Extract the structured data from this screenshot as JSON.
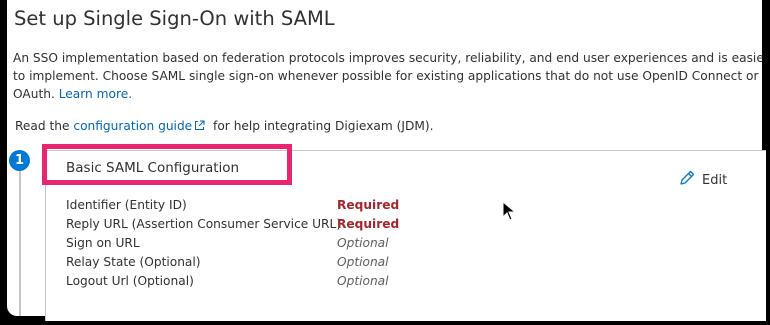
{
  "page": {
    "title": "Set up Single Sign-On with SAML",
    "intro_text": "An SSO implementation based on federation protocols improves security, reliability, and end user experiences and is easier to implement. Choose SAML single sign-on whenever possible for existing applications that do not use OpenID Connect or OAuth. ",
    "intro_link": "Learn more.",
    "read_prefix": "Read the ",
    "read_link": "configuration guide",
    "read_suffix": " for help integrating Digiexam (JDM)."
  },
  "step": {
    "number": "1",
    "title": "Basic SAML Configuration",
    "edit_label": "Edit",
    "fields": [
      {
        "label": "Identifier (Entity ID)",
        "value": "Required"
      },
      {
        "label": "Reply URL (Assertion Consumer Service URL)",
        "value": "Required"
      },
      {
        "label": "Sign on URL",
        "value": "Optional"
      },
      {
        "label": "Relay State (Optional)",
        "value": "Optional"
      },
      {
        "label": "Logout Url (Optional)",
        "value": "Optional"
      }
    ]
  },
  "colors": {
    "link": "#0067b8",
    "required": "#a4262c",
    "step_badge": "#0078d4",
    "highlight": "#e8266f"
  },
  "icons": {
    "external_link": "external-link-icon",
    "edit": "pencil-icon",
    "cursor": "mouse-pointer-icon"
  }
}
